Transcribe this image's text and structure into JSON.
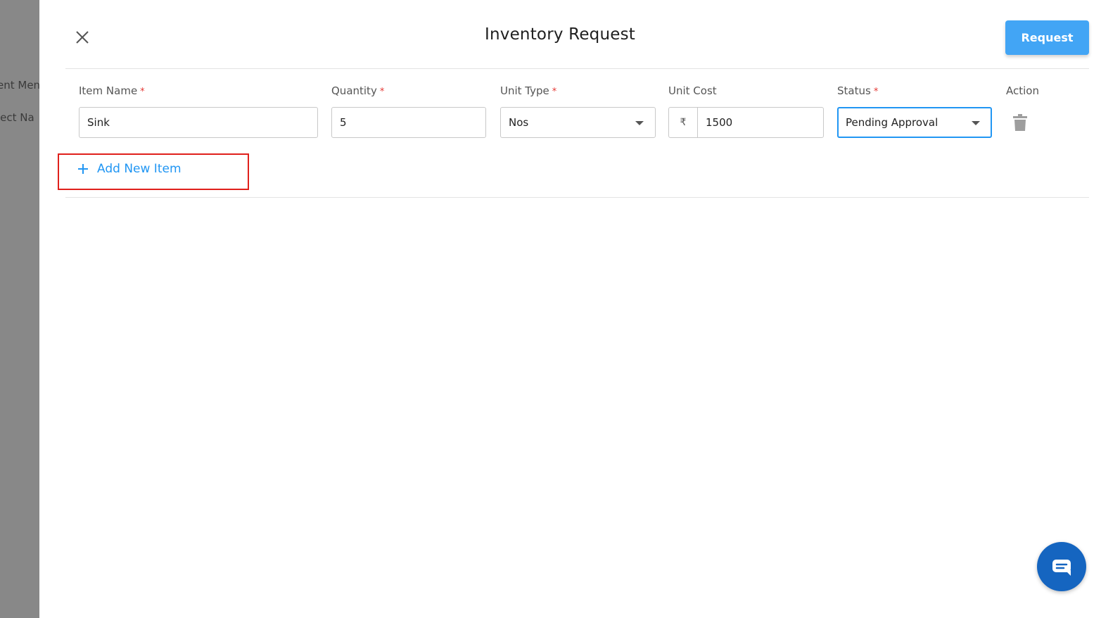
{
  "background": {
    "left_texts": [
      "ent Menu",
      "ject Na"
    ]
  },
  "header": {
    "title": "Inventory Request",
    "request_label": "Request"
  },
  "form": {
    "columns": {
      "item_name": "Item Name",
      "quantity": "Quantity",
      "unit_type": "Unit Type",
      "unit_cost": "Unit Cost",
      "status": "Status",
      "action": "Action"
    },
    "required_marker": "*",
    "row": {
      "item_name": "Sink",
      "quantity": "5",
      "unit_type": "Nos",
      "currency_symbol": "₹",
      "unit_cost": "1500",
      "status": "Pending Approval"
    },
    "add_item_label": "Add New Item"
  },
  "colors": {
    "accent": "#2196f3",
    "request_button": "#42a5f5",
    "required": "#e53935",
    "highlight": "#e0201b",
    "chat_button": "#1565c0"
  },
  "icons": {
    "close": "close-icon",
    "dropdown": "chevron-down-icon",
    "delete": "trash-icon",
    "add": "plus-icon",
    "chat": "chat-icon"
  }
}
